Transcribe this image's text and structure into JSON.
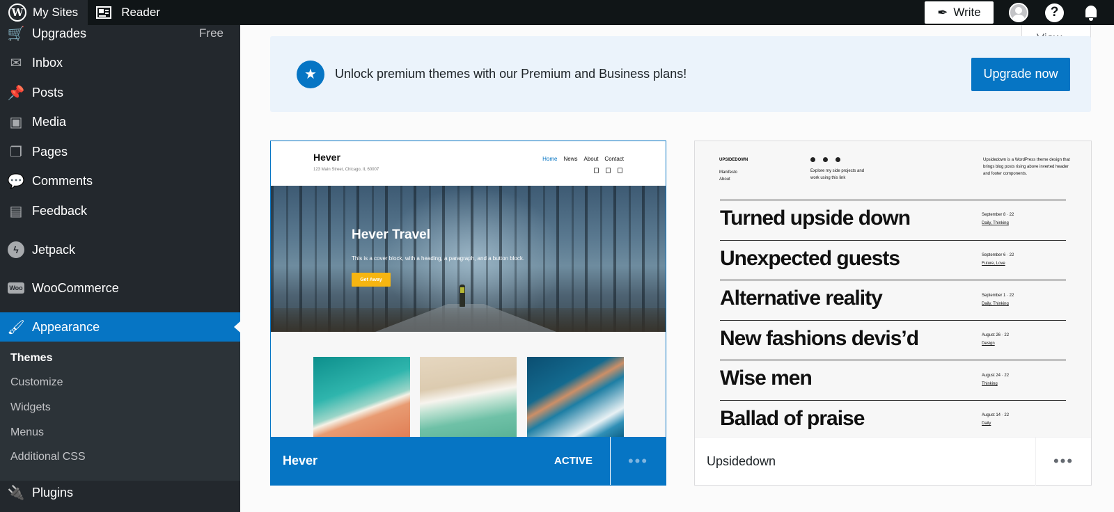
{
  "topbar": {
    "my_sites": "My Sites",
    "reader": "Reader",
    "write": "Write",
    "help_glyph": "?"
  },
  "sidebar": {
    "items": [
      {
        "label": "Upgrades",
        "badge": "Free",
        "icon": "cart-icon"
      },
      {
        "label": "Inbox",
        "icon": "mail-icon"
      },
      {
        "label": "Posts",
        "icon": "pin-icon"
      },
      {
        "label": "Media",
        "icon": "media-icon"
      },
      {
        "label": "Pages",
        "icon": "pages-icon"
      },
      {
        "label": "Comments",
        "icon": "comment-icon"
      },
      {
        "label": "Feedback",
        "icon": "feedback-icon"
      },
      {
        "label": "Jetpack",
        "icon": "jetpack-icon"
      },
      {
        "label": "WooCommerce",
        "icon": "woocommerce-icon"
      },
      {
        "label": "Appearance",
        "icon": "brush-icon"
      },
      {
        "label": "Plugins",
        "icon": "plug-icon"
      }
    ],
    "submenu": [
      "Themes",
      "Customize",
      "Widgets",
      "Menus",
      "Additional CSS"
    ],
    "woo_badge": "Woo"
  },
  "view_button": {
    "label": "View"
  },
  "banner": {
    "text": "Unlock premium themes with our Premium and Business plans!",
    "button": "Upgrade now"
  },
  "themes": [
    {
      "name": "Hever",
      "status": "ACTIVE",
      "more": "•••",
      "preview": {
        "title": "Hever",
        "address": "123 Main Street, Chicago, IL 60007",
        "nav": [
          "Home",
          "News",
          "About",
          "Contact"
        ],
        "cover_title": "Hever Travel",
        "cover_text": "This is a cover block, with a heading, a paragraph, and a button block.",
        "cover_button": "Get Away"
      }
    },
    {
      "name": "Upsidedown",
      "more": "•••",
      "preview": {
        "brand": "UPSIDEDOWN",
        "menu": [
          "Manifesto",
          "About"
        ],
        "explore": [
          "Explore my side projects and",
          "work using this link"
        ],
        "description": "Upsidedown is a WordPress theme design that brings blog posts rising above inverted header and footer components.",
        "posts": [
          {
            "title": "Turned upside down",
            "date": "September 8 · 22",
            "tags": "Daily, Thinking"
          },
          {
            "title": "Unexpected guests",
            "date": "September 6 · 22",
            "tags": "Future, Love"
          },
          {
            "title": "Alternative reality",
            "date": "September 1 · 22",
            "tags": "Daily, Thinking"
          },
          {
            "title": "New fashions devis’d",
            "date": "August 26 · 22",
            "tags": "Design"
          },
          {
            "title": "Wise men",
            "date": "August 24 · 22",
            "tags": "Thinking"
          },
          {
            "title": "Ballad of praise",
            "date": "August 14 · 22",
            "tags": "Daily"
          }
        ]
      }
    }
  ],
  "colors": {
    "accent": "#0675c4",
    "sidebar": "#23282d",
    "topbar": "#101517"
  }
}
